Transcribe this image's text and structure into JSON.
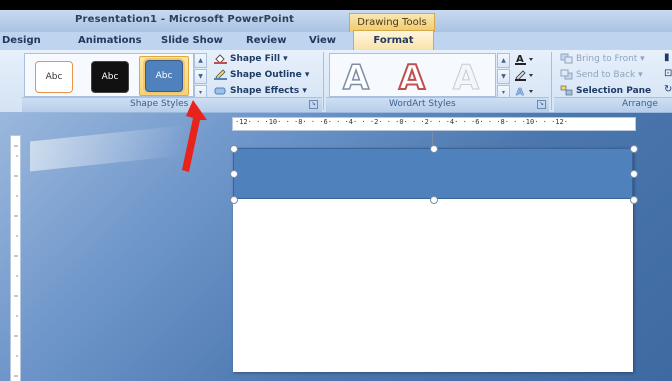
{
  "window": {
    "title": "Presentation1 - Microsoft PowerPoint",
    "contextual_title": "Drawing Tools"
  },
  "tabs": [
    {
      "label": "Design"
    },
    {
      "label": "Animations"
    },
    {
      "label": "Slide Show"
    },
    {
      "label": "Review"
    },
    {
      "label": "View"
    },
    {
      "label": "Format",
      "active": true
    }
  ],
  "ribbon": {
    "shape_styles": {
      "group_label": "Shape Styles",
      "thumbnails": [
        "Abc",
        "Abc",
        "Abc"
      ],
      "selected_index": 2,
      "commands": [
        "Shape Fill",
        "Shape Outline",
        "Shape Effects"
      ]
    },
    "wordart_styles": {
      "group_label": "WordArt Styles",
      "thumbnails": [
        "A",
        "A",
        "A"
      ]
    },
    "arrange": {
      "group_label": "Arrange",
      "commands": [
        "Bring to Front",
        "Send to Back",
        "Selection Pane"
      ]
    }
  },
  "ruler": {
    "top_text": "·12· · ·10· · ·8· · ·6· · ·4· · ·2· · ·0· · ·2· · ·4· · ·6· · ·8· · ·10· · ·12·"
  },
  "colors": {
    "shape_fill": "#4f81bd",
    "annotation_arrow": "#e8231c",
    "format_tab": "#f9e3ab"
  }
}
